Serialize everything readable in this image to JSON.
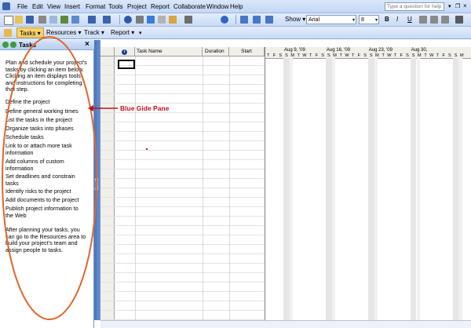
{
  "menu": [
    "File",
    "Edit",
    "View",
    "Insert",
    "Format",
    "Tools",
    "Project",
    "Report",
    "Collaborate",
    "Window",
    "Help"
  ],
  "help_placeholder": "Type a question for help",
  "toolbar1": {
    "show_label": "Show",
    "font": "Arial",
    "size": "8",
    "bold": "B",
    "italic": "I",
    "underline": "U"
  },
  "toolbar2": {
    "items": [
      "Tasks",
      "Resources",
      "Track",
      "Report"
    ]
  },
  "task_pane": {
    "title": "Tasks",
    "intro": "Plan and schedule your project's tasks by clicking an item below. Clicking an item displays tools and instructions for completing that step.",
    "items": [
      "Define the project",
      "Define general working times",
      "List the tasks in the project",
      "Organize tasks into phases",
      "Schedule tasks",
      "Link to or attach more task information",
      "Add columns of custom information",
      "Set deadlines and constrain tasks",
      "Identify risks to the project",
      "Add documents to the project",
      "Publish project information to the Web"
    ],
    "outro": "After planning your tasks, you can go to the Resources area to build your project's team and assign people to tasks."
  },
  "gantt_label": "Gantt Chart",
  "table": {
    "columns": [
      "",
      "Task Name",
      "Duration",
      "Start"
    ],
    "info_icon": "i"
  },
  "gantt": {
    "weeks": [
      "Aug 9, '09",
      "Aug 16, '09",
      "Aug 23, '09",
      "Aug 30,"
    ],
    "days": [
      "T",
      "F",
      "S",
      "S",
      "M",
      "T",
      "W",
      "T",
      "F",
      "S",
      "S",
      "M",
      "T",
      "W",
      "T",
      "F",
      "S",
      "S",
      "M",
      "T",
      "W",
      "T",
      "F",
      "S",
      "S",
      "M",
      "T",
      "W",
      "T",
      "F",
      "S",
      "S",
      "M"
    ]
  },
  "annotation": "Blue Gide Pane",
  "colors": {
    "accent": "#c0101e",
    "pane_strip": "#4a74b8"
  }
}
